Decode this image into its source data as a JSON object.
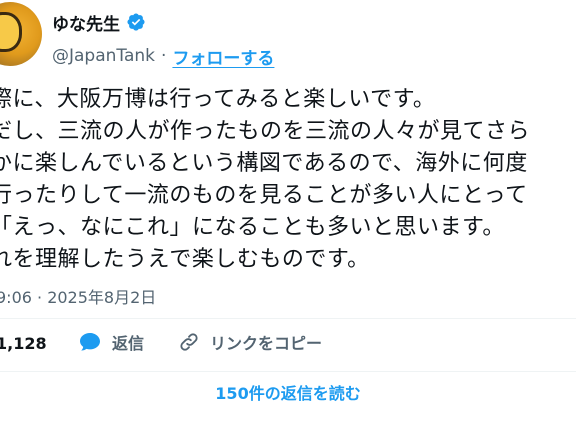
{
  "author": {
    "display_name": "ゆな先生",
    "handle": "@JapanTank",
    "separator": "·",
    "follow_label": "フォローする",
    "verified": true,
    "avatar_icon": "profile-avatar"
  },
  "tweet": {
    "lines": [
      "際に、大阪万博は行ってみると楽しいです。",
      "だし、三流の人が作ったものを三流の人々が見てさら",
      "かに楽しんでいるという構図であるので、海外に何度",
      "行ったりして一流のものを見ることが多い人にとって",
      "「えっ、なにこれ」になることも多いと思います。",
      "れを理解したうえで楽しむものです。"
    ],
    "timestamp": "9:06 · 2025年8月2日"
  },
  "actions": {
    "likes_count": "1,128",
    "reply_label": "返信",
    "copy_link_label": "リンクをコピー",
    "like_icon": "heart-icon",
    "reply_icon": "speech-bubble-icon",
    "copy_icon": "link-icon"
  },
  "replies": {
    "read_label": "150件の返信を読む"
  },
  "colors": {
    "accent": "#1d9bf0",
    "text": "#0f1419",
    "muted": "#536471",
    "divider": "#eff3f4",
    "like": "#f91880"
  }
}
